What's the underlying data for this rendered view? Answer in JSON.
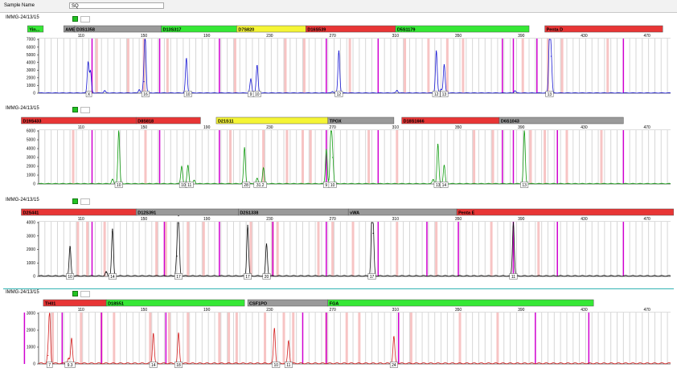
{
  "sample_header": {
    "label": "Sample Name",
    "value": "SQ"
  },
  "panels": [
    {
      "title": "IMMG-24/13/15",
      "loci": [
        {
          "name": "Yin...",
          "color": "#35e835",
          "start": 76,
          "end": 86
        },
        {
          "name": "AMEL",
          "color": "#9a9a9a",
          "start": 99,
          "end": 106
        },
        {
          "name": "D3S1358",
          "color": "#9a9a9a",
          "start": 106,
          "end": 161
        },
        {
          "name": "D13S317",
          "color": "#35e835",
          "start": 161,
          "end": 209
        },
        {
          "name": "D7S820",
          "color": "#f5f535",
          "start": 209,
          "end": 253
        },
        {
          "name": "D16S539",
          "color": "#e83535",
          "start": 253,
          "end": 310
        },
        {
          "name": "D5S1179",
          "color": "#35e835",
          "start": 310,
          "end": 395
        },
        {
          "name": "Penta D",
          "color": "#e83535",
          "start": 405,
          "end": 480
        }
      ],
      "scale_labels": [
        "110",
        "150",
        "190",
        "230",
        "270",
        "310",
        "350",
        "390",
        "430",
        "470"
      ],
      "yaxis": {
        "max": 7000,
        "ticks": [
          "7000",
          "6000",
          "5000",
          "4000",
          "3000",
          "2000",
          "1000",
          "0"
        ]
      },
      "trace_color": "#1a1ad4",
      "peaks": [
        {
          "bp": 114.5,
          "h": 4000
        },
        {
          "bp": 116,
          "h": 2800
        },
        {
          "bp": 125,
          "h": 300
        },
        {
          "bp": 147,
          "h": 450
        },
        {
          "bp": 150.8,
          "h": 7000
        },
        {
          "bp": 150,
          "h": 1500
        },
        {
          "bp": 177,
          "h": 4500
        },
        {
          "bp": 218,
          "h": 1800
        },
        {
          "bp": 222,
          "h": 3600
        },
        {
          "bp": 274,
          "h": 5500
        },
        {
          "bp": 270,
          "h": 200
        },
        {
          "bp": 311,
          "h": 350
        },
        {
          "bp": 336,
          "h": 5500
        },
        {
          "bp": 341,
          "h": 3700
        },
        {
          "bp": 339,
          "h": 500
        },
        {
          "bp": 386,
          "h": 300
        },
        {
          "bp": 408,
          "h": 7000
        },
        {
          "bp": 409,
          "h": 4800
        }
      ],
      "alleles": [
        {
          "bp": 115,
          "label": "X"
        },
        {
          "bp": 151,
          "label": "16"
        },
        {
          "bp": 178,
          "label": "10"
        },
        {
          "bp": 218,
          "label": "9"
        },
        {
          "bp": 222,
          "label": "10"
        },
        {
          "bp": 274,
          "label": "12"
        },
        {
          "bp": 336,
          "label": "12"
        },
        {
          "bp": 341,
          "label": "13"
        },
        {
          "bp": 408,
          "label": "13"
        }
      ],
      "magenta_bp": [
        117,
        160,
        198,
        266,
        299,
        378,
        385,
        400,
        455
      ],
      "red_bp": [
        120,
        140,
        150,
        165,
        208,
        240,
        252,
        281,
        316,
        331,
        343,
        353,
        391,
        407,
        416,
        445
      ]
    },
    {
      "title": "IMMG-24/13/15",
      "loci": [
        {
          "name": "D19S433",
          "color": "#e83535",
          "start": 72,
          "end": 145
        },
        {
          "name": "D8S818",
          "color": "#e83535",
          "start": 145,
          "end": 186
        },
        {
          "name": "D21S11",
          "color": "#f5f535",
          "start": 196,
          "end": 267
        },
        {
          "name": "TPOX",
          "color": "#9a9a9a",
          "start": 267,
          "end": 309
        },
        {
          "name": "D18S1666",
          "color": "#e83535",
          "start": 314,
          "end": 376
        },
        {
          "name": "D6S1043",
          "color": "#9a9a9a",
          "start": 376,
          "end": 455
        }
      ],
      "scale_labels": [
        "110",
        "150",
        "190",
        "230",
        "270",
        "310",
        "350",
        "390",
        "430",
        "470"
      ],
      "yaxis": {
        "max": 6000,
        "ticks": [
          "6000",
          "5000",
          "4000",
          "3000",
          "2000",
          "1000",
          "0"
        ]
      },
      "trace_color": "#129c12",
      "peaks": [
        {
          "bp": 134,
          "h": 6000
        },
        {
          "bp": 130,
          "h": 500
        },
        {
          "bp": 174,
          "h": 2000
        },
        {
          "bp": 178,
          "h": 2100
        },
        {
          "bp": 182,
          "h": 400
        },
        {
          "bp": 214,
          "h": 4100
        },
        {
          "bp": 226,
          "h": 1800
        },
        {
          "bp": 222,
          "h": 600
        },
        {
          "bp": 266,
          "h": 3900
        },
        {
          "bp": 269,
          "h": 6000
        },
        {
          "bp": 270,
          "h": 3000
        },
        {
          "bp": 337,
          "h": 4500
        },
        {
          "bp": 341,
          "h": 2100
        },
        {
          "bp": 334,
          "h": 500
        },
        {
          "bp": 392,
          "h": 6000
        }
      ],
      "alleles": [
        {
          "bp": 134,
          "label": "10"
        },
        {
          "bp": 175,
          "label": "10"
        },
        {
          "bp": 179,
          "label": "11"
        },
        {
          "bp": 215,
          "label": "28"
        },
        {
          "bp": 224,
          "label": "31.2"
        },
        {
          "bp": 266,
          "label": "9"
        },
        {
          "bp": 270,
          "label": "10"
        },
        {
          "bp": 337,
          "label": "13"
        },
        {
          "bp": 341,
          "label": "14"
        },
        {
          "bp": 392,
          "label": "13"
        }
      ],
      "magenta_bp": [
        117,
        160,
        198,
        266,
        299,
        378,
        385,
        413,
        455
      ],
      "red_bp": [
        105,
        151,
        205,
        226,
        241,
        251,
        256,
        293,
        311,
        360,
        372,
        396,
        405,
        419,
        441
      ]
    },
    {
      "title": "IMMG-24/13/15",
      "loci": [
        {
          "name": "D2S441",
          "color": "#e83535",
          "start": 72,
          "end": 145
        },
        {
          "name": "D12S391",
          "color": "#9a9a9a",
          "start": 145,
          "end": 210
        },
        {
          "name": "D2S1338",
          "color": "#9a9a9a",
          "start": 210,
          "end": 280
        },
        {
          "name": "vWA",
          "color": "#9a9a9a",
          "start": 280,
          "end": 349
        },
        {
          "name": "Penta E",
          "color": "#e83535",
          "start": 349,
          "end": 487
        }
      ],
      "scale_labels": [
        "110",
        "150",
        "190",
        "230",
        "270",
        "310",
        "350",
        "390",
        "430",
        "470"
      ],
      "yaxis": {
        "max": 4000,
        "ticks": [
          "4000",
          "3000",
          "2000",
          "1000",
          "0"
        ]
      },
      "trace_color": "#111111",
      "peaks": [
        {
          "bp": 103,
          "h": 2200
        },
        {
          "bp": 130,
          "h": 3500
        },
        {
          "bp": 126,
          "h": 300
        },
        {
          "bp": 172,
          "h": 4500
        },
        {
          "bp": 171,
          "h": 1500
        },
        {
          "bp": 216,
          "h": 3800
        },
        {
          "bp": 228,
          "h": 2400
        },
        {
          "bp": 295,
          "h": 4000
        },
        {
          "bp": 295.8,
          "h": 3200
        },
        {
          "bp": 385,
          "h": 4000
        }
      ],
      "alleles": [
        {
          "bp": 103,
          "label": "10"
        },
        {
          "bp": 130,
          "label": "14"
        },
        {
          "bp": 172,
          "label": "17"
        },
        {
          "bp": 216,
          "label": "17"
        },
        {
          "bp": 228,
          "label": "20"
        },
        {
          "bp": 295,
          "label": "17"
        },
        {
          "bp": 385,
          "label": "11"
        }
      ],
      "magenta_bp": [
        117,
        163,
        198,
        232,
        266,
        299,
        330,
        350,
        385,
        413,
        455
      ],
      "red_bp": [
        108,
        114,
        125,
        158,
        164,
        178,
        188,
        218,
        232,
        235,
        261,
        270,
        283,
        311,
        336,
        371,
        401
      ]
    },
    {
      "title": "IMMG-24/13/15",
      "loci": [
        {
          "name": "TH01",
          "color": "#e83535",
          "start": 86,
          "end": 126
        },
        {
          "name": "D18S51",
          "color": "#35e835",
          "start": 126,
          "end": 214
        },
        {
          "name": "CSF1PO",
          "color": "#9a9a9a",
          "start": 216,
          "end": 267
        },
        {
          "name": "FGA",
          "color": "#35e835",
          "start": 267,
          "end": 436
        }
      ],
      "scale_labels": [
        "110",
        "150",
        "190",
        "230",
        "270",
        "310",
        "350",
        "390",
        "430",
        "470"
      ],
      "yaxis": {
        "max": 3000,
        "ticks": [
          "3000",
          "2000",
          "1000",
          "0"
        ]
      },
      "trace_color": "#d42020",
      "peaks": [
        {
          "bp": 90,
          "h": 3000
        },
        {
          "bp": 89,
          "h": 500
        },
        {
          "bp": 104,
          "h": 1500
        },
        {
          "bp": 102,
          "h": 300
        },
        {
          "bp": 156,
          "h": 1800
        },
        {
          "bp": 172,
          "h": 1800
        },
        {
          "bp": 233,
          "h": 2100
        },
        {
          "bp": 242,
          "h": 1350
        },
        {
          "bp": 309,
          "h": 1600
        }
      ],
      "alleles": [
        {
          "bp": 90,
          "label": "7"
        },
        {
          "bp": 103,
          "label": "9.3"
        },
        {
          "bp": 156,
          "label": "14"
        },
        {
          "bp": 172,
          "label": "18"
        },
        {
          "bp": 234,
          "label": "10"
        },
        {
          "bp": 242,
          "label": "11"
        },
        {
          "bp": 309,
          "label": "24"
        }
      ],
      "magenta_bp": [
        74,
        98,
        123,
        164,
        251,
        266,
        312,
        399,
        433
      ],
      "red_bp": [
        92,
        110,
        123,
        131,
        154,
        166,
        178,
        198,
        204,
        209,
        227,
        239,
        245,
        266,
        279,
        287,
        320,
        351,
        375
      ]
    }
  ]
}
